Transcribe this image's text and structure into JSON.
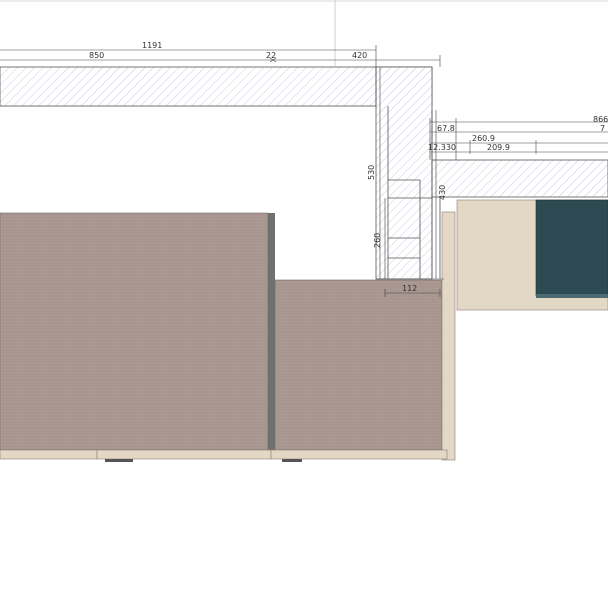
{
  "drawing": {
    "colors": {
      "wall_hatch": "#9aa0c8",
      "wall_fill": "#ffffff",
      "cabinet_fill": "#a8968f",
      "cabinet_side": "#6e6e6e",
      "panel_beige": "#e2d6c5",
      "dark_panel": "#2c4a52",
      "dim_line": "#444444"
    },
    "dimensions": {
      "top_total": "1191",
      "top_left": "850",
      "top_gap": "22",
      "top_right": "420",
      "vert_530": "530",
      "vert_260": "260",
      "vert_430": "430",
      "horiz_112": "112",
      "r_866": "866",
      "r_7": "7",
      "r_67_8": "67.8",
      "r_260_9": "260.9",
      "r_12_330": "12.330",
      "r_209_9": "209.9"
    }
  }
}
